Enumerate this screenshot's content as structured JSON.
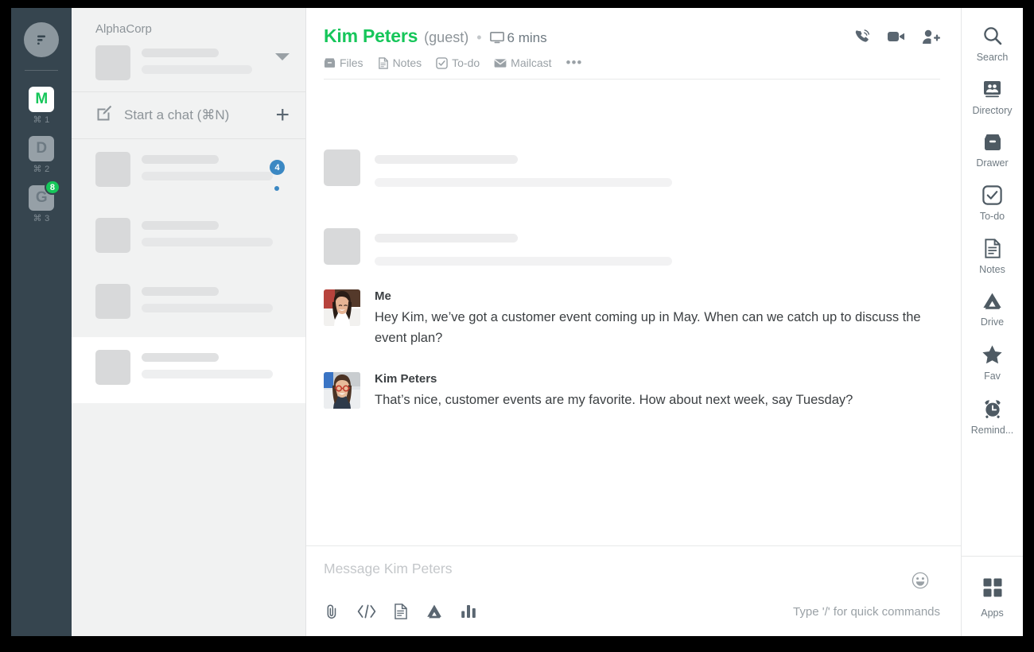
{
  "org_rail": {
    "logo_icon": "chat-bubble-logo",
    "items": [
      {
        "letter": "M",
        "shortcut": "⌘ 1",
        "active": true,
        "badge": ""
      },
      {
        "letter": "D",
        "shortcut": "⌘ 2",
        "active": false,
        "badge": ""
      },
      {
        "letter": "G",
        "shortcut": "⌘ 3",
        "active": false,
        "badge": "8"
      }
    ]
  },
  "list_panel": {
    "workspace_name": "AlphaCorp",
    "caret_icon": "chevron-down-icon",
    "start_chat": {
      "icon": "compose-icon",
      "label": "Start a chat (⌘N)",
      "plus": "+"
    },
    "items": [
      {
        "unread_count": "4",
        "has_dot": true,
        "active": false
      },
      {
        "unread_count": "",
        "has_dot": false,
        "active": false
      },
      {
        "unread_count": "",
        "has_dot": false,
        "active": false
      },
      {
        "unread_count": "",
        "has_dot": false,
        "active": true
      }
    ]
  },
  "conversation": {
    "name": "Kim Peters",
    "guest_label": "(guest)",
    "separator": "•",
    "presence_icon": "monitor-icon",
    "time": "6 mins",
    "accent_color": "#16c65a",
    "header_actions": [
      {
        "name": "call-icon",
        "title": "Call"
      },
      {
        "name": "video-icon",
        "title": "Video"
      },
      {
        "name": "add-person-icon",
        "title": "Add people"
      }
    ],
    "tabs": [
      {
        "label": "Files",
        "icon": "files-icon"
      },
      {
        "label": "Notes",
        "icon": "notes-icon"
      },
      {
        "label": "To-do",
        "icon": "todo-icon"
      },
      {
        "label": "Mailcast",
        "icon": "mailcast-icon"
      }
    ],
    "tabs_more": "•••",
    "skeleton_messages": 2,
    "messages": [
      {
        "author": "Me",
        "avatar": "avatar-me",
        "text": "Hey Kim, we’ve got a customer event coming up in May. When can we catch up to discuss the event plan?"
      },
      {
        "author": "Kim Peters",
        "avatar": "avatar-kim",
        "text": "That’s nice, customer events are my favorite. How about next week, say Tuesday?"
      }
    ]
  },
  "composer": {
    "placeholder": "Message Kim Peters",
    "emoji_icon": "emoji-icon",
    "hint": "Type '/' for quick commands",
    "tools": [
      {
        "name": "attachment-icon"
      },
      {
        "name": "code-icon"
      },
      {
        "name": "document-icon"
      },
      {
        "name": "drive-icon"
      },
      {
        "name": "poll-icon"
      }
    ]
  },
  "right_rail": {
    "items": [
      {
        "label": "Search",
        "icon": "search-icon"
      },
      {
        "label": "Directory",
        "icon": "directory-icon"
      },
      {
        "label": "Drawer",
        "icon": "drawer-icon"
      },
      {
        "label": "To-do",
        "icon": "todo-icon"
      },
      {
        "label": "Notes",
        "icon": "notes-icon"
      },
      {
        "label": "Drive",
        "icon": "drive-icon"
      },
      {
        "label": "Fav",
        "icon": "star-icon"
      },
      {
        "label": "Remind...",
        "icon": "alarm-clock-icon"
      }
    ],
    "bottom": {
      "label": "Apps",
      "icon": "apps-grid-icon"
    }
  }
}
